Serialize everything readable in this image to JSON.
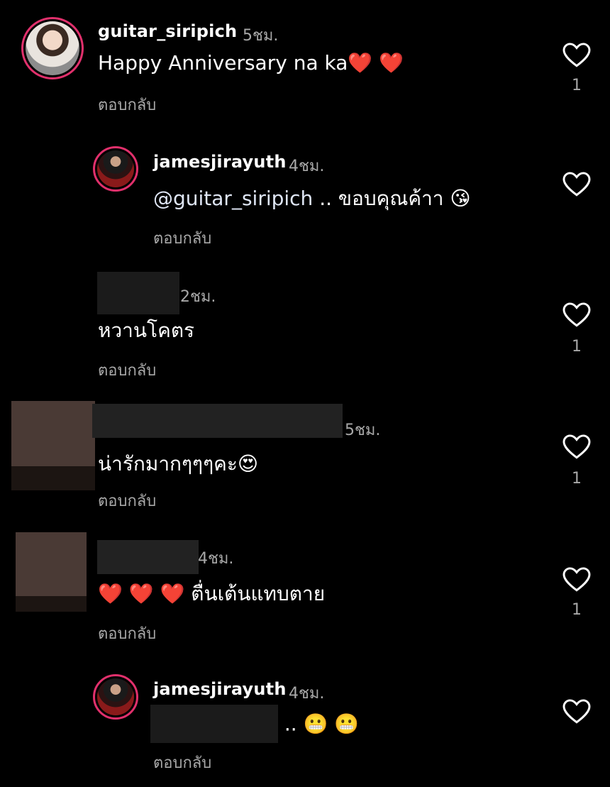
{
  "comments": [
    {
      "username": "guitar_siripich",
      "time": "5ชม.",
      "text": "Happy Anniversary na ka❤️ ❤️",
      "reply": "ตอบกลับ",
      "likes": "1"
    },
    {
      "username": "jamesjirayuth",
      "time": "4ชม.",
      "mention": "@guitar_siripich",
      "text": " .. ขอบคุณค้าา 😘",
      "reply": "ตอบกลับ"
    },
    {
      "time": "2ชม.",
      "text": "หวานโคตร",
      "reply": "ตอบกลับ",
      "likes": "1"
    },
    {
      "time": "5ชม.",
      "text": "น่ารักมากๆๆๆคะ😍",
      "reply": "ตอบกลับ",
      "likes": "1"
    },
    {
      "time": "4ชม.",
      "text": "❤️ ❤️ ❤️  ตื่นเต้นแทบตาย",
      "reply": "ตอบกลับ",
      "likes": "1"
    },
    {
      "username": "jamesjirayuth",
      "time": "4ชม.",
      "text": " .. 😬 😬",
      "reply": "ตอบกลับ"
    }
  ],
  "icons": {
    "like": "heart-outline-icon"
  },
  "colors": {
    "background": "#000000",
    "text": "#ffffff",
    "secondary": "#a8a8a8",
    "ring": "#e1306c"
  }
}
